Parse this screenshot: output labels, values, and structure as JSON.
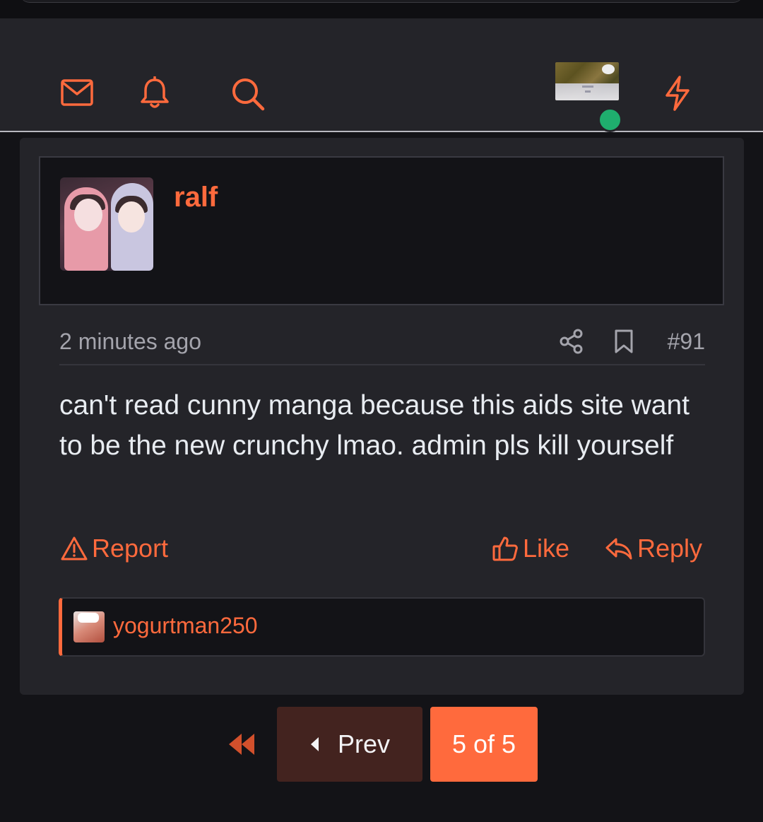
{
  "colors": {
    "accent": "#ff6a3d",
    "background": "#131317",
    "card": "#242429",
    "online": "#1fae6e",
    "prev_button_bg": "#43231f"
  },
  "header": {
    "icons": [
      "mail-icon",
      "bell-icon",
      "search-icon",
      "bolt-icon"
    ],
    "user_avatar": {
      "status": "online"
    }
  },
  "post": {
    "author": "ralf",
    "timestamp": "2 minutes ago",
    "post_number": "#91",
    "body": "can't read cunny manga because this aids site want to be the new crunchy lmao. admin pls kill yourself",
    "actions": {
      "report": "Report",
      "like": "Like",
      "reply": "Reply"
    },
    "liked_by": [
      "yogurtman250"
    ]
  },
  "pagination": {
    "prev_label": "Prev",
    "page_indicator": "5 of 5"
  }
}
